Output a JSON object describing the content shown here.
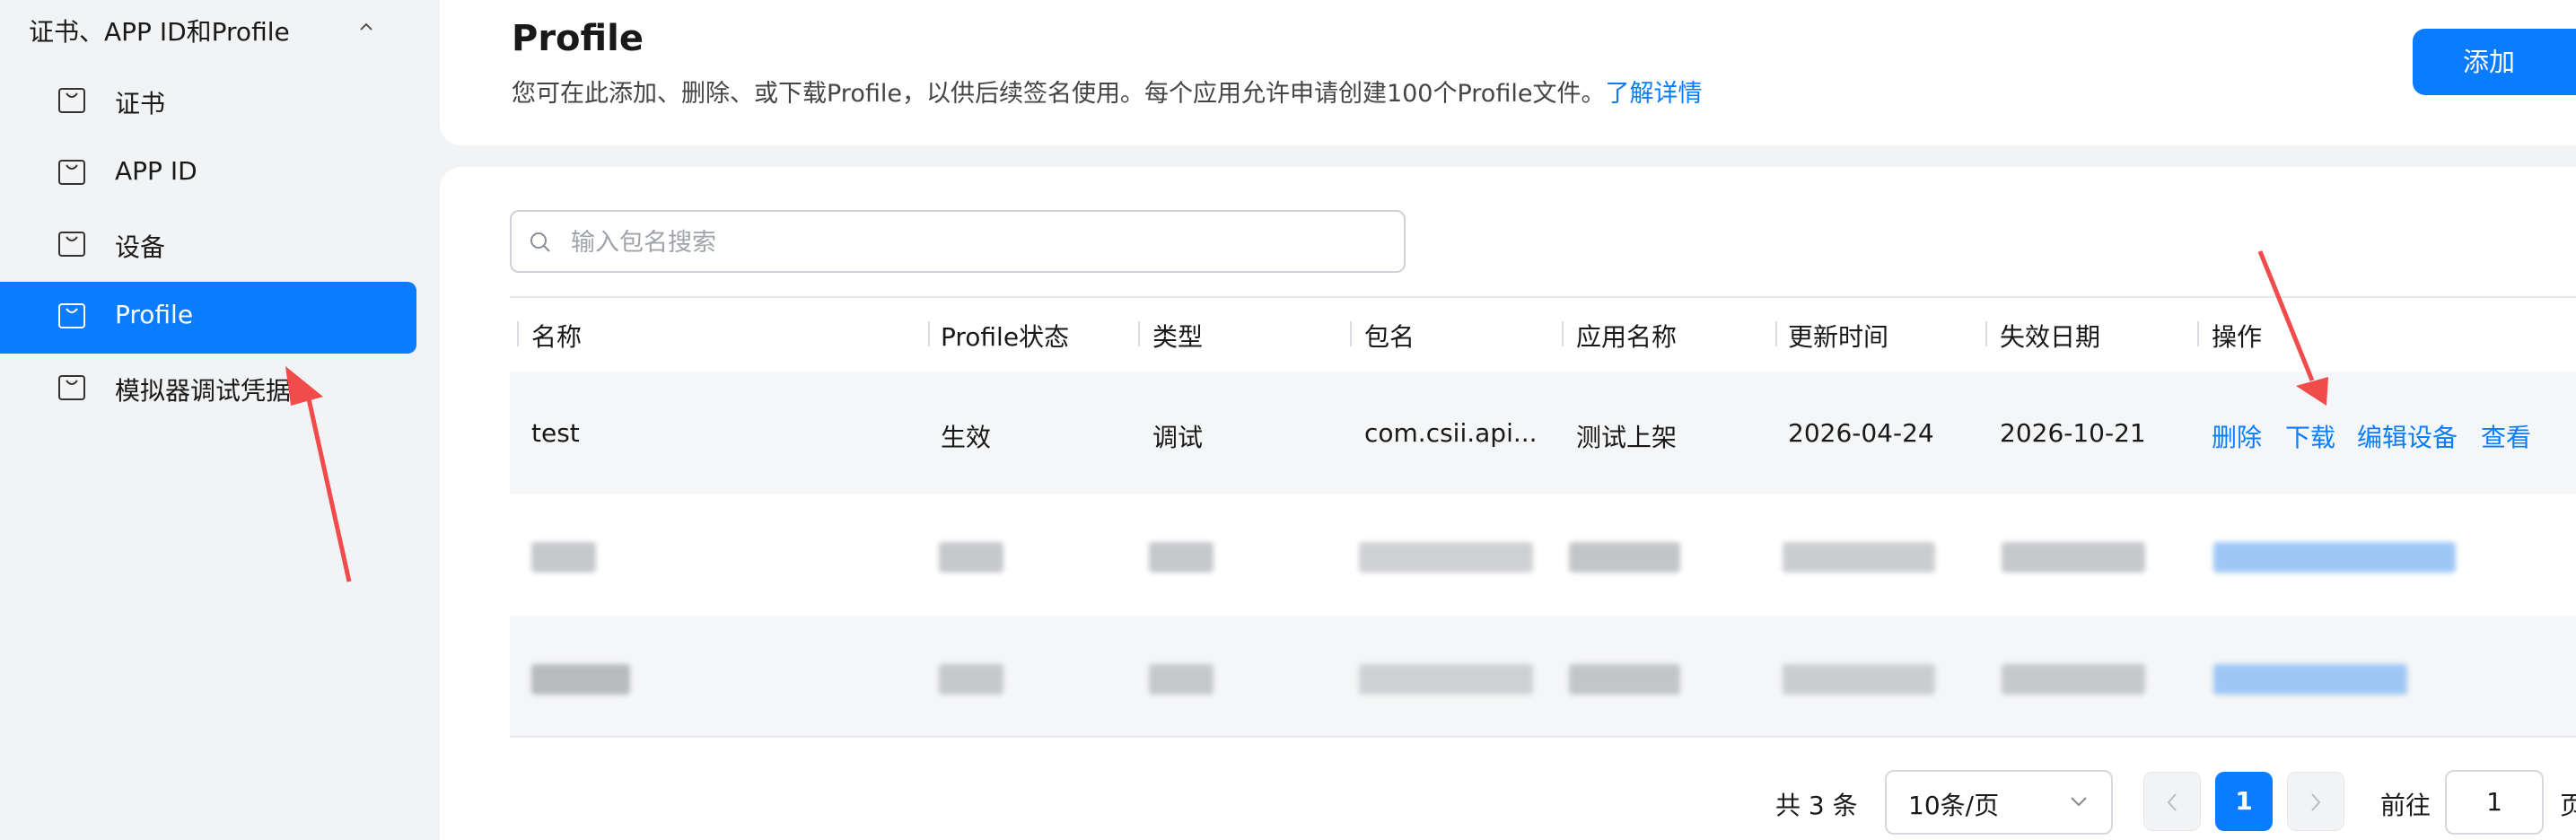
{
  "sidebar": {
    "group_title": "证书、APP ID和Profile",
    "items": [
      {
        "label": "证书"
      },
      {
        "label": "APP ID"
      },
      {
        "label": "设备"
      },
      {
        "label": "Profile"
      },
      {
        "label": "模拟器调试凭据"
      }
    ]
  },
  "header": {
    "title": "Profile",
    "description": "您可在此添加、删除、或下载Profile，以供后续签名使用。每个应用允许申请创建100个Profile文件。",
    "learn_more": "了解详情",
    "add_button": "添加"
  },
  "search": {
    "placeholder": "输入包名搜索"
  },
  "table": {
    "columns": [
      "名称",
      "Profile状态",
      "类型",
      "包名",
      "应用名称",
      "更新时间",
      "失效日期",
      "操作"
    ],
    "rows": [
      {
        "name": "test",
        "status": "生效",
        "type": "调试",
        "package": "com.csii.api...",
        "app_name": "测试上架",
        "updated": "2026-04-24",
        "expires": "2026-10-21",
        "actions": [
          "删除",
          "下载",
          "编辑设备",
          "查看"
        ]
      }
    ]
  },
  "pagination": {
    "total": "共 3 条",
    "page_size": "10条/页",
    "current_page": "1",
    "goto_label": "前往",
    "goto_value": "1",
    "page_suffix": "页"
  },
  "colors": {
    "accent": "#0a7cff",
    "annotation_arrow": "#f24b4b"
  }
}
